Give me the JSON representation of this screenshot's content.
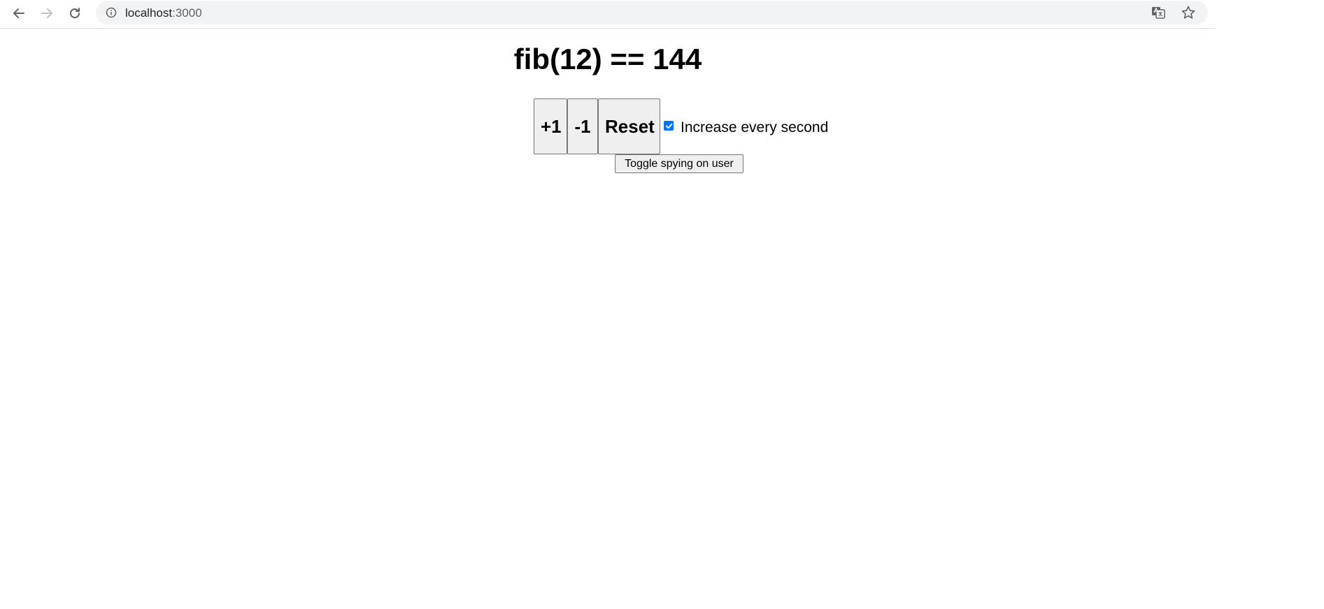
{
  "browser": {
    "url_host": "localhost",
    "url_port": ":3000",
    "icons": [
      "back-arrow-icon",
      "forward-arrow-icon",
      "reload-icon",
      "info-icon",
      "translate-icon",
      "star-icon"
    ]
  },
  "main": {
    "title": "fib(12) == 144",
    "increment_label": "+1",
    "decrement_label": "-1",
    "reset_label": "Reset",
    "auto_increase_checked": true,
    "auto_increase_label": "Increase every second",
    "toggle_spy_label": "Toggle spying on user"
  },
  "colors": {
    "checkbox_accent": "#0075ff",
    "omnibox_bg": "#f1f3f4",
    "button_bg": "#efefef"
  }
}
